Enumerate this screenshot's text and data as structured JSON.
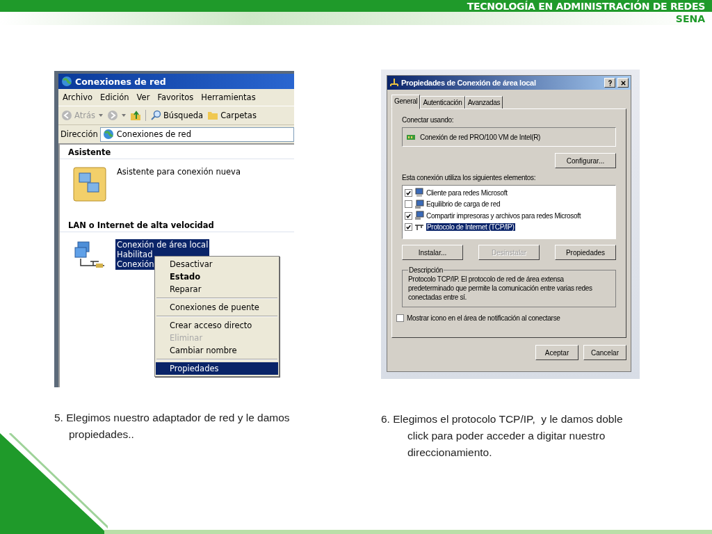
{
  "header": {
    "title": "TECNOLOGÍA EN ADMINISTRACIÓN DE REDES",
    "subtitle": "SENA"
  },
  "explorer": {
    "title": "Conexiones de red",
    "menu": [
      "Archivo",
      "Edición",
      "Ver",
      "Favoritos",
      "Herramientas"
    ],
    "toolbar": [
      {
        "label": "Atrás",
        "kind": "back",
        "disabled": true
      },
      {
        "kind": "forward",
        "disabled": true
      },
      {
        "kind": "up"
      },
      {
        "label": "Búsqueda",
        "kind": "search"
      },
      {
        "label": "Carpetas",
        "kind": "folders"
      }
    ],
    "address": {
      "label": "Dirección",
      "value": "Conexiones de red"
    },
    "sections": [
      {
        "heading": "Asistente",
        "items": [
          {
            "kind": "wizard",
            "lines": [
              "Asistente para conexión nueva"
            ],
            "selected": false
          }
        ]
      },
      {
        "heading": "LAN o Internet de alta velocidad",
        "items": [
          {
            "kind": "lan",
            "lines": [
              "Conexión de área local",
              "Habilitad",
              "Conexión"
            ],
            "selected": true
          }
        ]
      }
    ],
    "context_menu": [
      {
        "kind": "item",
        "label": "Desactivar",
        "bold": false,
        "disabled": false,
        "selected": false
      },
      {
        "kind": "item",
        "label": "Estado",
        "bold": true,
        "disabled": false,
        "selected": false
      },
      {
        "kind": "item",
        "label": "Reparar",
        "bold": false,
        "disabled": false,
        "selected": false
      },
      {
        "kind": "separator"
      },
      {
        "kind": "item",
        "label": "Conexiones de puente",
        "bold": false,
        "disabled": false,
        "selected": false
      },
      {
        "kind": "separator"
      },
      {
        "kind": "item",
        "label": "Crear acceso directo",
        "bold": false,
        "disabled": false,
        "selected": false
      },
      {
        "kind": "item",
        "label": "Eliminar",
        "bold": false,
        "disabled": true,
        "selected": false
      },
      {
        "kind": "item",
        "label": "Cambiar nombre",
        "bold": false,
        "disabled": false,
        "selected": false
      },
      {
        "kind": "separator"
      },
      {
        "kind": "item",
        "label": "Propiedades",
        "bold": false,
        "disabled": false,
        "selected": true
      }
    ],
    "caption": "5. Elegimos nuestro adaptador de red y le damos propiedades.."
  },
  "dialog": {
    "title": "Propiedades de Conexión de área local",
    "tabs": [
      {
        "label": "General",
        "selected": true
      },
      {
        "label": "Autenticación",
        "selected": false
      },
      {
        "label": "Avanzadas",
        "selected": false
      }
    ],
    "connect_label": "Conectar usando:",
    "adapter": "Conexión de red PRO/100 VM de Intel(R)",
    "configure": "Configurar...",
    "components_label": "Esta conexión utiliza los siguientes elementos:",
    "components": [
      {
        "label": "Cliente para redes Microsoft",
        "kind": "client",
        "checked": true,
        "selected": false
      },
      {
        "label": "Equilibrio de carga de red",
        "kind": "service",
        "checked": false,
        "selected": false
      },
      {
        "label": "Compartir impresoras y archivos para redes Microsoft",
        "kind": "service",
        "checked": true,
        "selected": false
      },
      {
        "label": "Protocolo de Internet (TCP/IP)",
        "kind": "protocol",
        "checked": true,
        "selected": true
      }
    ],
    "buttons": [
      {
        "label": "Instalar...",
        "disabled": false
      },
      {
        "label": "Desinstalar",
        "disabled": true
      },
      {
        "label": "Propiedades",
        "disabled": false
      }
    ],
    "description": {
      "legend": "Descripción",
      "text": "Protocolo TCP/IP. El protocolo de red de área extensa predeterminado que permite la comunicación entre varias redes conectadas entre sí."
    },
    "notify": {
      "label": "Mostrar icono en el área de notificación al conectarse",
      "checked": false
    },
    "footer": [
      "Aceptar",
      "Cancelar"
    ],
    "caption": "6. Elegimos el protocolo TCP/IP,  y le damos doble click para poder acceder a digitar nuestro direccionamiento."
  }
}
